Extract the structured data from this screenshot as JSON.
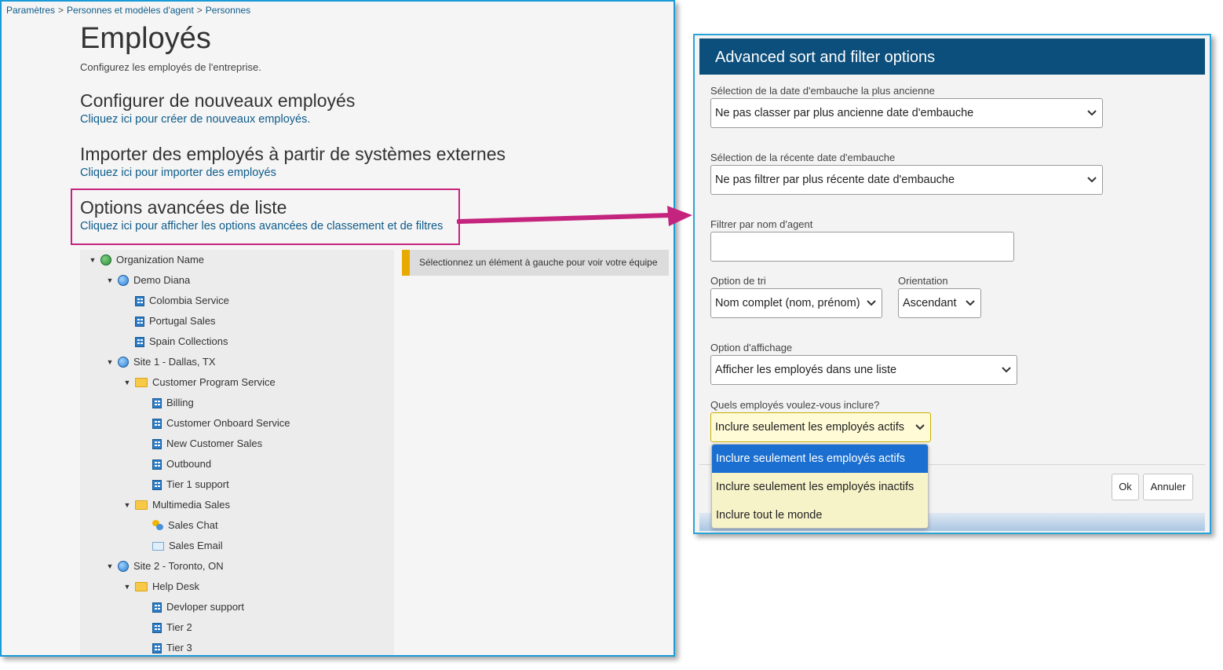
{
  "breadcrumb": {
    "items": [
      "Paramètres",
      "Personnes et modèles d'agent",
      "Personnes"
    ],
    "separator": ">"
  },
  "page": {
    "title": "Employés",
    "subtitle": "Configurez les employés de l'entreprise."
  },
  "sections": [
    {
      "title": "Configurer de nouveaux employés",
      "link": "Cliquez ici pour créer de nouveaux employés."
    },
    {
      "title": "Importer des employés à partir de systèmes externes",
      "link": "Cliquez ici pour importer des employés"
    },
    {
      "title": "Options avancées de liste",
      "link": "Cliquez ici pour afficher les options avancées de classement et de filtres"
    }
  ],
  "tree": [
    {
      "label": "Organization Name",
      "icon": "globe-green-icon",
      "level": 0,
      "expanded": true
    },
    {
      "label": "Demo Diana",
      "icon": "globe-icon",
      "level": 1,
      "expanded": true
    },
    {
      "label": "Colombia Service",
      "icon": "building-icon",
      "level": 2
    },
    {
      "label": "Portugal Sales",
      "icon": "building-icon",
      "level": 2
    },
    {
      "label": "Spain Collections",
      "icon": "building-icon",
      "level": 2
    },
    {
      "label": "Site 1 - Dallas, TX",
      "icon": "globe-icon",
      "level": 1,
      "expanded": true
    },
    {
      "label": "Customer Program Service",
      "icon": "folder-icon",
      "level": 2,
      "expanded": true
    },
    {
      "label": "Billing",
      "icon": "building-icon",
      "level": 3
    },
    {
      "label": "Customer Onboard Service",
      "icon": "building-icon",
      "level": 3
    },
    {
      "label": "New Customer Sales",
      "icon": "building-icon",
      "level": 3
    },
    {
      "label": "Outbound",
      "icon": "building-icon",
      "level": 3
    },
    {
      "label": "Tier 1 support",
      "icon": "building-icon",
      "level": 3
    },
    {
      "label": "Multimedia Sales",
      "icon": "folder-icon",
      "level": 2,
      "expanded": true
    },
    {
      "label": "Sales Chat",
      "icon": "chat-icon",
      "level": 3
    },
    {
      "label": "Sales Email",
      "icon": "email-icon",
      "level": 3
    },
    {
      "label": "Site 2 - Toronto, ON",
      "icon": "globe-icon",
      "level": 1,
      "expanded": true
    },
    {
      "label": "Help Desk",
      "icon": "folder-icon",
      "level": 2,
      "expanded": true
    },
    {
      "label": "Devloper support",
      "icon": "building-icon",
      "level": 3
    },
    {
      "label": "Tier 2",
      "icon": "building-icon",
      "level": 3
    },
    {
      "label": "Tier 3",
      "icon": "building-icon",
      "level": 3
    }
  ],
  "team_message": "Sélectionnez un élément à gauche pour voir votre équipe",
  "dialog": {
    "title": "Advanced sort and filter options",
    "oldest_hire_label": "Sélection de la date d'embauche la plus ancienne",
    "oldest_hire_value": "Ne pas classer par plus ancienne date d'embauche",
    "recent_hire_label": "Sélection de la récente date d'embauche",
    "recent_hire_value": "Ne pas filtrer par plus récente date d'embauche",
    "agent_name_label": "Filtrer par nom d'agent",
    "agent_name_value": "",
    "sort_label": "Option de tri",
    "sort_value": "Nom complet (nom, prénom)",
    "orientation_label": "Orientation",
    "orientation_value": "Ascendant",
    "display_label": "Option d'affichage",
    "display_value": "Afficher les employés dans une liste",
    "include_label": "Quels employés voulez-vous inclure?",
    "include_value": "Inclure seulement les employés actifs",
    "include_options": [
      "Inclure seulement les employés actifs",
      "Inclure seulement les employés inactifs",
      "Inclure tout le monde"
    ],
    "ok_label": "Ok",
    "cancel_label": "Annuler"
  },
  "colors": {
    "dialog_header": "#0c4f7c",
    "link": "#0d5b8a",
    "highlight_box": "#c4237e",
    "arrow": "#c4237e",
    "dropdown_selected": "#1a6fd0",
    "dropdown_bg": "#f7f3c9",
    "message_accent": "#e8a900"
  }
}
